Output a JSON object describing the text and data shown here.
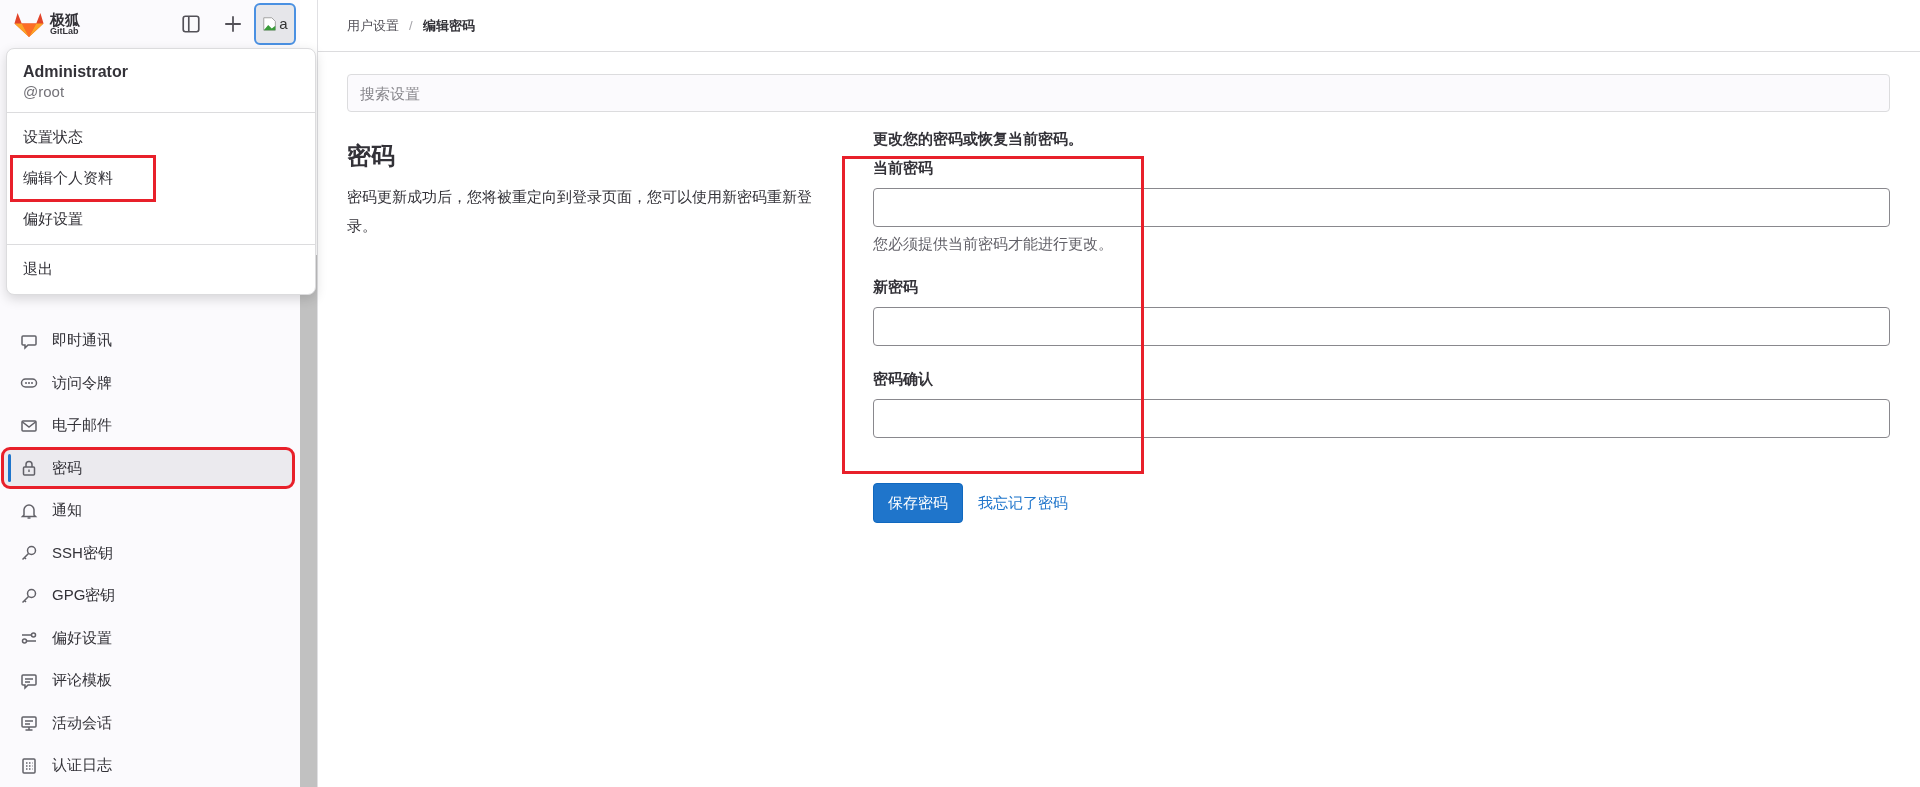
{
  "brand": {
    "name": "极狐",
    "sub": "GitLab"
  },
  "avatar": {
    "alt": "a"
  },
  "user_menu": {
    "name": "Administrator",
    "handle": "@root",
    "groups": [
      [
        {
          "label": "设置状态",
          "marked": false
        },
        {
          "label": "编辑个人资料",
          "marked": true
        },
        {
          "label": "偏好设置",
          "marked": false
        }
      ],
      [
        {
          "label": "退出",
          "marked": false
        }
      ]
    ]
  },
  "sidebar": {
    "items": [
      {
        "label": "即时通讯",
        "selected": false,
        "marked": false
      },
      {
        "label": "访问令牌",
        "selected": false,
        "marked": false
      },
      {
        "label": "电子邮件",
        "selected": false,
        "marked": false
      },
      {
        "label": "密码",
        "selected": true,
        "marked": true
      },
      {
        "label": "通知",
        "selected": false,
        "marked": false
      },
      {
        "label": "SSH密钥",
        "selected": false,
        "marked": false
      },
      {
        "label": "GPG密钥",
        "selected": false,
        "marked": false
      },
      {
        "label": "偏好设置",
        "selected": false,
        "marked": false
      },
      {
        "label": "评论模板",
        "selected": false,
        "marked": false
      },
      {
        "label": "活动会话",
        "selected": false,
        "marked": false
      },
      {
        "label": "认证日志",
        "selected": false,
        "marked": false
      }
    ]
  },
  "breadcrumb": {
    "items": [
      "用户设置",
      "编辑密码"
    ],
    "separator": "/"
  },
  "search": {
    "placeholder": "搜索设置"
  },
  "section": {
    "title": "密码",
    "description": "密码更新成功后，您将被重定向到登录页面，您可以使用新密码重新登录。"
  },
  "form": {
    "heading": "更改您的密码或恢复当前密码。",
    "marked": true,
    "fields": [
      {
        "label": "当前密码",
        "help": "您必须提供当前密码才能进行更改。"
      },
      {
        "label": "新密码"
      },
      {
        "label": "密码确认"
      }
    ],
    "submit": "保存密码",
    "forgot_link": "我忘记了密码"
  }
}
